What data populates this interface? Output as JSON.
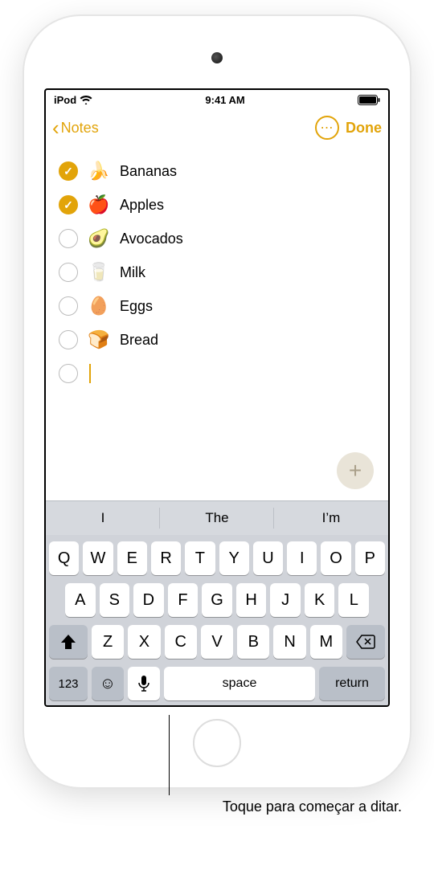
{
  "status": {
    "carrier": "iPod",
    "time": "9:41 AM"
  },
  "nav": {
    "back_label": "Notes",
    "done_label": "Done"
  },
  "checklist": {
    "items": [
      {
        "checked": true,
        "emoji": "🍌",
        "label": "Bananas"
      },
      {
        "checked": true,
        "emoji": "🍎",
        "label": "Apples"
      },
      {
        "checked": false,
        "emoji": "🥑",
        "label": "Avocados"
      },
      {
        "checked": false,
        "emoji": "🥛",
        "label": "Milk"
      },
      {
        "checked": false,
        "emoji": "🥚",
        "label": "Eggs"
      },
      {
        "checked": false,
        "emoji": "🍞",
        "label": "Bread"
      }
    ]
  },
  "suggestions": [
    "I",
    "The",
    "I’m"
  ],
  "keyboard": {
    "row1": [
      "Q",
      "W",
      "E",
      "R",
      "T",
      "Y",
      "U",
      "I",
      "O",
      "P"
    ],
    "row2": [
      "A",
      "S",
      "D",
      "F",
      "G",
      "H",
      "J",
      "K",
      "L"
    ],
    "row3": [
      "Z",
      "X",
      "C",
      "V",
      "B",
      "N",
      "M"
    ],
    "numKey": "123",
    "space": "space",
    "returnKey": "return"
  },
  "callout": {
    "text": "Toque para começar a ditar."
  }
}
